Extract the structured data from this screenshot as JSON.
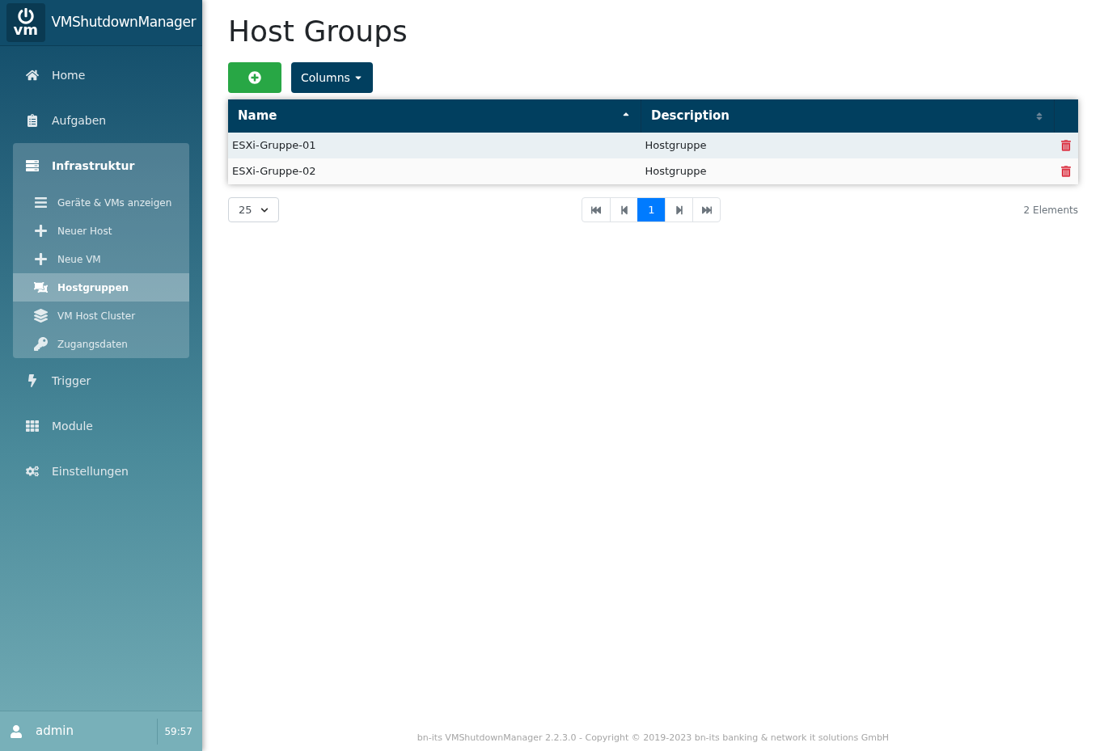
{
  "app": {
    "title": "VMShutdownManager",
    "logo_text": "vm"
  },
  "nav": [
    {
      "label": "Home",
      "selected": false
    },
    {
      "label": "Aufgaben",
      "selected": false
    },
    {
      "label": "Infrastruktur",
      "selected": false,
      "expanded": true,
      "children": [
        {
          "label": "Geräte & VMs anzeigen",
          "selected": false
        },
        {
          "label": "Neuer Host",
          "selected": false
        },
        {
          "label": "Neue VM",
          "selected": false
        },
        {
          "label": "Hostgruppen",
          "selected": true
        },
        {
          "label": "VM Host Cluster",
          "selected": false
        },
        {
          "label": "Zugangsdaten",
          "selected": false
        }
      ]
    },
    {
      "label": "Trigger",
      "selected": false
    },
    {
      "label": "Module",
      "selected": false
    },
    {
      "label": "Einstellungen",
      "selected": false
    }
  ],
  "user": {
    "name": "admin",
    "timer": "59:57"
  },
  "page": {
    "title": "Host Groups"
  },
  "toolbar": {
    "columns_button": "Columns"
  },
  "table": {
    "columns": [
      {
        "label": "Name",
        "sorted": true
      },
      {
        "label": "Description",
        "sorted": false
      }
    ],
    "rows": [
      {
        "cells": [
          "ESXi-Gruppe-01",
          "Hostgruppe"
        ]
      },
      {
        "cells": [
          "ESXi-Gruppe-02",
          "Hostgruppe"
        ]
      }
    ]
  },
  "page_size": "25",
  "pagination": {
    "pages": [
      {
        "label": "1",
        "selected": true
      }
    ]
  },
  "count": "2 Elements",
  "footer": "bn-its VMShutdownManager 2.2.3.0 - Copyright © 2019-2023 bn-its banking & network it solutions GmbH"
}
